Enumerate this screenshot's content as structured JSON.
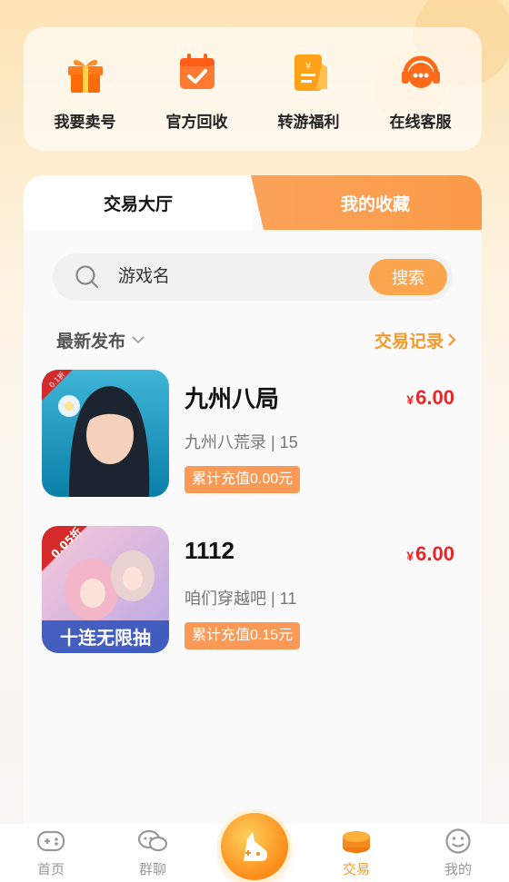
{
  "quick_menu": [
    {
      "label": "我要卖号",
      "icon": "gift-icon"
    },
    {
      "label": "官方回收",
      "icon": "calendar-check-icon"
    },
    {
      "label": "转游福利",
      "icon": "receipt-icon"
    },
    {
      "label": "在线客服",
      "icon": "headset-icon"
    }
  ],
  "tabs": {
    "hall": "交易大厅",
    "favorites": "我的收藏"
  },
  "search": {
    "placeholder": "游戏名",
    "button": "搜索"
  },
  "filter": {
    "sort_label": "最新发布",
    "records_label": "交易记录"
  },
  "listings": [
    {
      "title": "九州八局",
      "price": "6.00",
      "currency": "¥",
      "subtitle": "九州八荒录 | 15",
      "recharge": "累计充值0.00元",
      "discount_tag": "0.1折"
    },
    {
      "title": "1112",
      "price": "6.00",
      "currency": "¥",
      "subtitle": "咱们穿越吧 | 11",
      "recharge": "累计充值0.15元",
      "discount_tag": "0.05折",
      "banner_text": "十连无限抽"
    }
  ],
  "nav": [
    {
      "label": "首页",
      "icon": "gamepad-icon"
    },
    {
      "label": "群聊",
      "icon": "chat-icon"
    },
    {
      "label": "",
      "icon": "center-game-icon"
    },
    {
      "label": "交易",
      "icon": "coins-icon",
      "active": true
    },
    {
      "label": "我的",
      "icon": "smile-icon"
    }
  ],
  "colors": {
    "accent": "#fba64f",
    "price": "#e8262a",
    "records": "#f39a2c"
  }
}
